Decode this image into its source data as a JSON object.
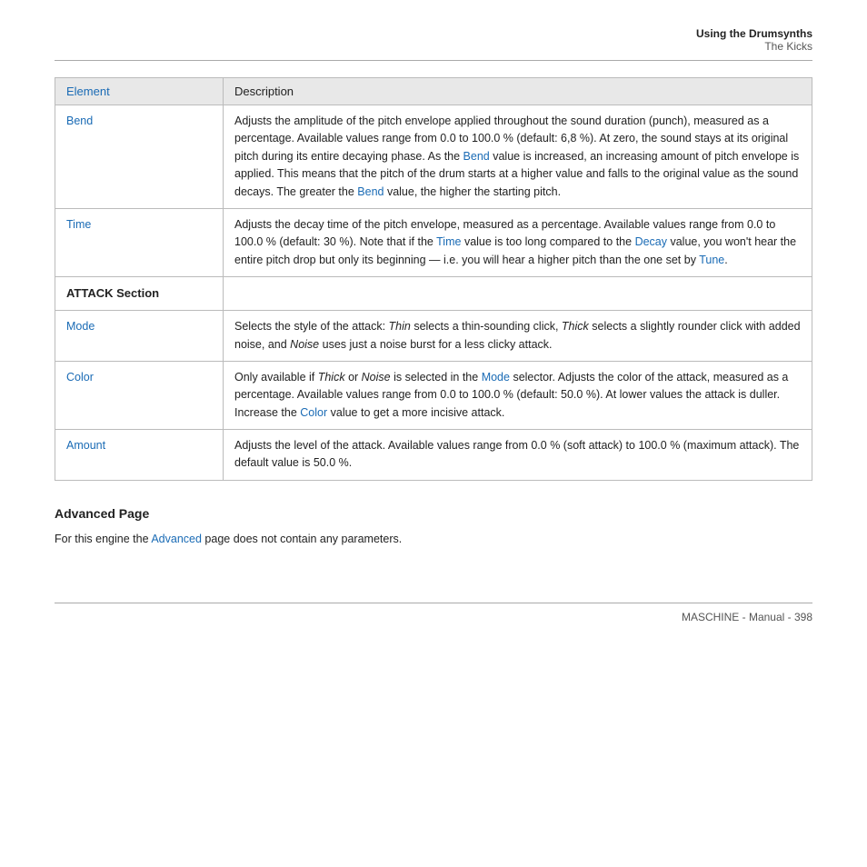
{
  "header": {
    "title": "Using the Drumsynths",
    "subtitle": "The Kicks"
  },
  "table": {
    "col1_header": "Element",
    "col2_header": "Description",
    "rows": [
      {
        "element": "Bend",
        "element_is_link": true,
        "description": "Adjusts the amplitude of the pitch envelope applied throughout the sound duration (punch), measured as a percentage. Available values range from 0.0 to 100.0 % (default: 6,8 %). At zero, the sound stays at its original pitch during its entire decaying phase. As the [Bend] value is increased, an increasing amount of pitch envelope is applied. This means that the pitch of the drum starts at a higher value and falls to the original value as the sound decays. The greater the [Bend] value, the higher the starting pitch.",
        "desc_links": [
          {
            "word": "Bend",
            "count": 2
          }
        ],
        "type": "normal"
      },
      {
        "element": "Time",
        "element_is_link": true,
        "description": "Adjusts the decay time of the pitch envelope, measured as a percentage. Available values range from 0.0 to 100.0 % (default: 30 %). Note that if the [Time] value is too long compared to the [Decay] value, you won't hear the entire pitch drop but only its beginning — i.e. you will hear a higher pitch than the one set by [Tune].",
        "type": "normal"
      },
      {
        "element": "ATTACK Section",
        "element_is_link": false,
        "description": "",
        "type": "section"
      },
      {
        "element": "Mode",
        "element_is_link": true,
        "description": "Selects the style of the attack: Thin selects a thin-sounding click, Thick selects a slightly rounder click with added noise, and Noise uses just a noise burst for a less clicky attack.",
        "type": "normal"
      },
      {
        "element": "Color",
        "element_is_link": true,
        "description": "Only available if Thick or Noise is selected in the [Mode] selector. Adjusts the color of the attack, measured as a percentage. Available values range from 0.0 to 100.0 % (default: 50.0 %). At lower values the attack is duller. Increase the [Color] value to get a more incisive attack.",
        "type": "normal"
      },
      {
        "element": "Amount",
        "element_is_link": true,
        "description": "Adjusts the level of the attack. Available values range from 0.0 % (soft attack) to 100.0 % (maximum attack). The default value is 50.0 %.",
        "type": "normal"
      }
    ]
  },
  "advanced": {
    "title": "Advanced Page",
    "text_before_link": "For this engine the ",
    "link_text": "Advanced",
    "text_after_link": " page does not contain any parameters."
  },
  "footer": {
    "text": "MASCHINE - Manual - 398"
  }
}
